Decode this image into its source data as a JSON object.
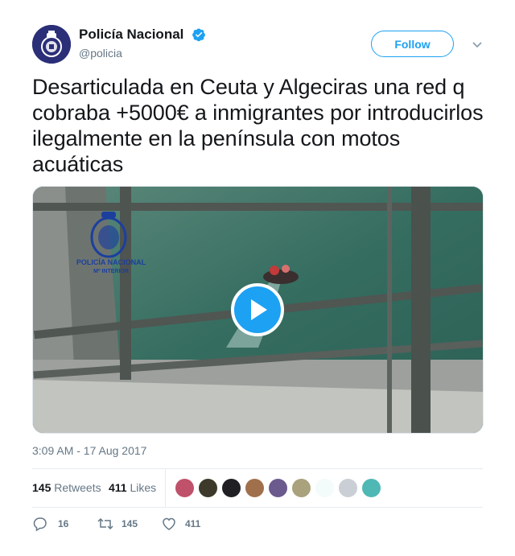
{
  "account": {
    "display_name": "Policía Nacional",
    "handle": "@policia",
    "verified": true,
    "follow_label": "Follow"
  },
  "tweet": {
    "text": "Desarticulada en Ceuta y Algeciras una red q cobraba +5000€ a inmigrantes por introducirlos ilegalmente en la península con motos acuáticas",
    "timestamp": "3:09 AM - 17 Aug 2017"
  },
  "media": {
    "watermark_line1": "POLICÍA NACIONAL",
    "watermark_line2": "Mº INTERIOR",
    "type": "video"
  },
  "stats": {
    "retweets_count": "145",
    "retweets_label": "Retweets",
    "likes_count": "411",
    "likes_label": "Likes",
    "likers_shown": 9
  },
  "actions": {
    "reply_count": "16",
    "retweet_count": "145",
    "like_count": "411"
  },
  "colors": {
    "accent": "#1da1f2",
    "text": "#14171a",
    "muted": "#657786",
    "border": "#e6ecf0"
  }
}
